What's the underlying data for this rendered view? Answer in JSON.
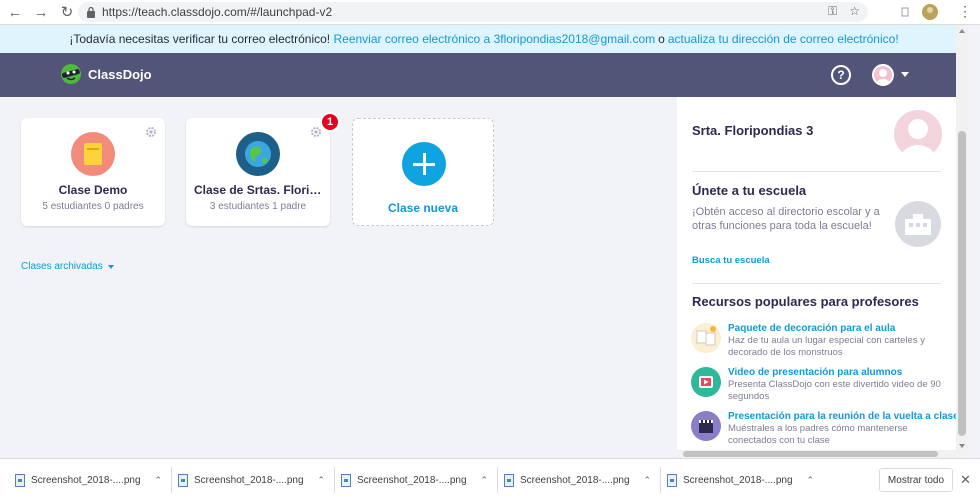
{
  "browser": {
    "url": "https://teach.classdojo.com/#/launchpad-v2"
  },
  "banner": {
    "prompt": "¡Todavía necesitas verificar tu correo electrónico!",
    "resend_link": "Reenviar correo electrónico a 3floripondias2018@gmail.com",
    "or": "o",
    "update_link": "actualiza tu dirección de correo electrónico!"
  },
  "header": {
    "logo_text": "ClassDojo",
    "help_label": "?"
  },
  "classes": [
    {
      "name": "Clase Demo",
      "subtitle": "5 estudiantes 0 padres"
    },
    {
      "name": "Clase de Srtas. Floripo...",
      "subtitle": "3 estudiantes 1 padre",
      "badge": "1"
    }
  ],
  "new_class": {
    "label": "Clase nueva"
  },
  "archived": {
    "label": "Clases archivadas"
  },
  "panel": {
    "teacher_name": "Srta. Floripondias 3",
    "school": {
      "heading": "Únete a tu escuela",
      "description": "¡Obtén acceso al directorio escolar y a otras funciones para toda la escuela!",
      "link": "Busca tu escuela"
    },
    "resources": {
      "heading": "Recursos populares para profesores",
      "items": [
        {
          "title": "Paquete de decoración para el aula",
          "description": "Haz de tu aula un lugar especial con carteles y decorado de los monstruos"
        },
        {
          "title": "Video de presentación para alumnos",
          "description": "Presenta ClassDojo con este divertido video de 90 segundos"
        },
        {
          "title": "Presentación para la reunión de la vuelta a clases",
          "description": "Muéstrales a los padres cómo mantenerse conectados con tu clase"
        }
      ]
    }
  },
  "downloads": {
    "items": [
      {
        "name": "Screenshot_2018-....png"
      },
      {
        "name": "Screenshot_2018-....png"
      },
      {
        "name": "Screenshot_2018-....png"
      },
      {
        "name": "Screenshot_2018-....png"
      },
      {
        "name": "Screenshot_2018-....png"
      }
    ],
    "show_all": "Mostrar todo"
  },
  "colors": {
    "header_bg": "#535578",
    "accent_blue": "#0fa3e0",
    "banner_bg": "#dff4fd",
    "badge_red": "#e8001f"
  }
}
